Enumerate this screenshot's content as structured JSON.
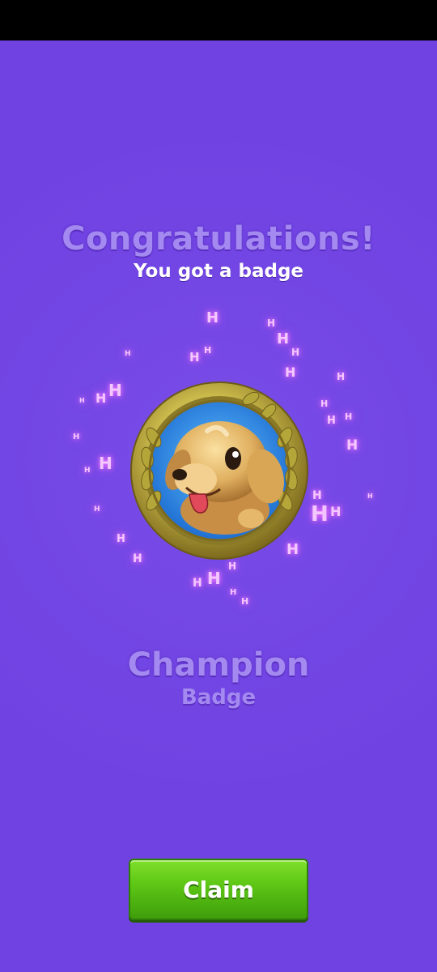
{
  "reward": {
    "title": "Congratulations!",
    "subtitle": "You got a badge",
    "badge_name": "Champion",
    "badge_type": "Badge",
    "badge_icon": "gold-medal-puppy-icon"
  },
  "actions": {
    "claim_label": "Claim"
  },
  "colors": {
    "background": "#7042e2",
    "heading_text": "#a489f0",
    "button_green": "#5bc414",
    "sparkle": "#ff7bff"
  }
}
